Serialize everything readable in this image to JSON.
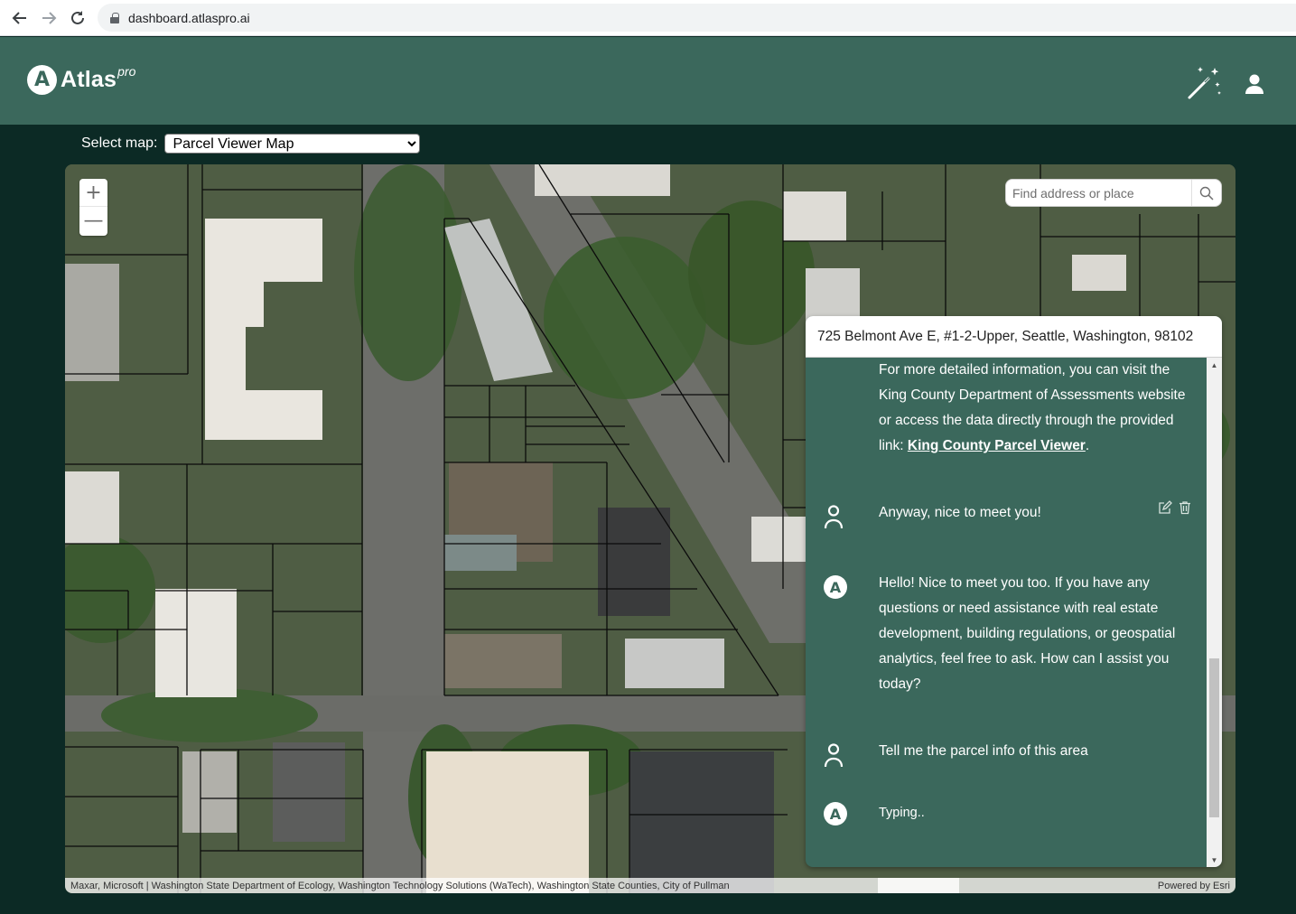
{
  "browser": {
    "url": "dashboard.atlaspro.ai"
  },
  "header": {
    "logo_text": "Atlas",
    "logo_superscript": "pro",
    "logo_mark": "A"
  },
  "map_selector": {
    "label": "Select map:",
    "selected": "Parcel Viewer Map"
  },
  "map": {
    "zoom_in": "+",
    "zoom_out": "—",
    "search_placeholder": "Find address or place",
    "attribution": "Maxar, Microsoft | Washington State Department of Ecology, Washington Technology Solutions (WaTech), Washington State Counties, City of Pullman",
    "powered_by": "Powered by Esri"
  },
  "chat": {
    "title": "725 Belmont Ave E, #1-2-Upper, Seattle, Washington, 98102",
    "messages": [
      {
        "role": "assistant",
        "text": "For more detailed information, you can visit the King County Department of Assessments website or access the data directly through the provided link: ",
        "link_text": "King County Parcel Viewer",
        "suffix": "."
      },
      {
        "role": "user",
        "text": "Anyway, nice to meet you!"
      },
      {
        "role": "assistant",
        "text": "Hello! Nice to meet you too. If you have any questions or need assistance with real estate development, building regulations, or geospatial analytics, feel free to ask. How can I assist you today?"
      },
      {
        "role": "user",
        "text": "Tell me the parcel info of this area"
      },
      {
        "role": "assistant",
        "text": "Typing.."
      }
    ],
    "bot_avatar": "A"
  },
  "colors": {
    "header_bg": "#3b685c",
    "page_bg": "#0c2a25",
    "chat_bg": "#3b685c"
  },
  "icons": [
    "back-arrow-icon",
    "forward-arrow-icon",
    "reload-icon",
    "lock-icon",
    "magic-wand-icon",
    "user-icon",
    "search-icon",
    "edit-icon",
    "trash-icon"
  ]
}
